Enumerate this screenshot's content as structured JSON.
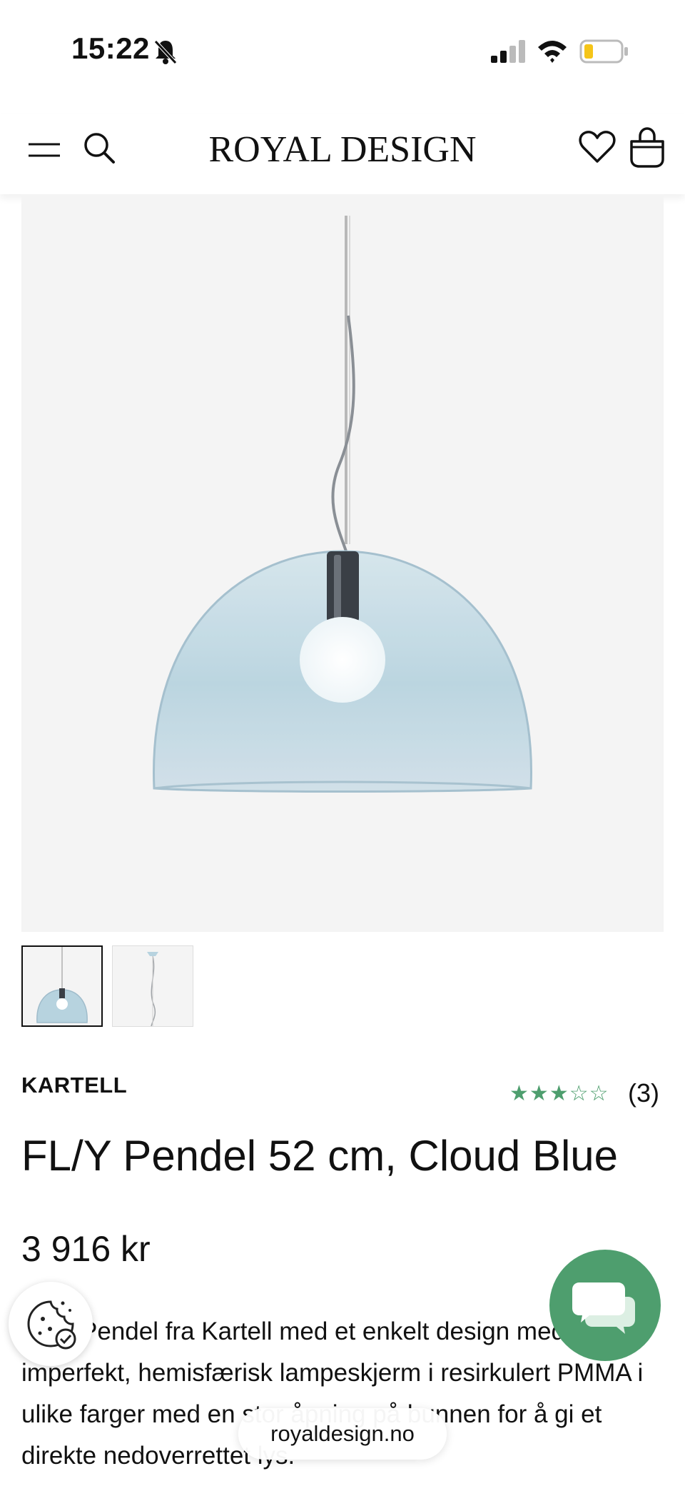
{
  "status_bar": {
    "time": "15:22",
    "icons": [
      "bell-slash-icon",
      "signal-icon",
      "wifi-icon",
      "battery-low-icon"
    ]
  },
  "header": {
    "logo": "ROYAL DESIGN",
    "icons": [
      "menu-icon",
      "search-icon",
      "heart-icon",
      "bag-icon"
    ]
  },
  "product": {
    "brand": "KARTELL",
    "rating": {
      "value": 3,
      "max": 5,
      "stars": "★★★☆☆",
      "count_label": "(3)"
    },
    "title": "FL/Y Pendel 52 cm, Cloud Blue",
    "price": "3 916 kr",
    "description": "FL/Y Pendel fra Kartell med et enkelt design med en imperfekt, hemisfærisk lampeskjerm i resirkulert PMMA i ulike farger med en stor åpning på bunnen for å gi et direkte nedoverrettet lys."
  },
  "gallery": {
    "thumbnails": [
      "thumbnail-1",
      "thumbnail-2"
    ],
    "selected_index": 0
  },
  "browser": {
    "url": "royaldesign.no"
  },
  "colors": {
    "accent_green": "#4e9e6e",
    "background": "#ffffff",
    "image_bg": "#f4f4f4",
    "shade_blue": "#b7d3df"
  }
}
